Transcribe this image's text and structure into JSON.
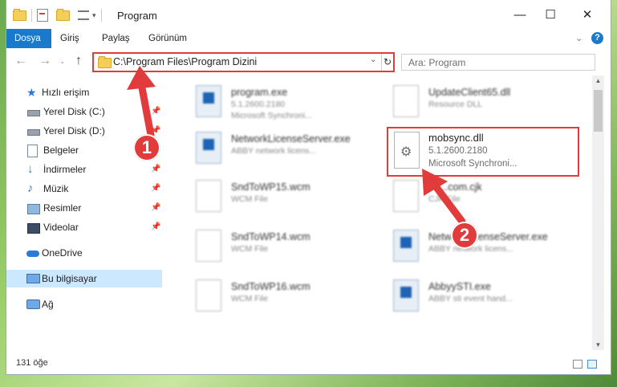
{
  "window": {
    "title": "Program",
    "controls": {
      "minimize": "—",
      "maximize": "☐",
      "close": "✕"
    }
  },
  "ribbon": {
    "tabs": [
      "Dosya",
      "Giriş",
      "Paylaş",
      "Görünüm"
    ],
    "active_tab": "Dosya",
    "help": "?"
  },
  "address": {
    "path": "C:\\Program Files\\Program Dizini",
    "search_placeholder": "Ara: Program"
  },
  "sidebar": {
    "quick_access": "Hızlı erişim",
    "items": [
      {
        "label": "Yerel Disk (C:)",
        "icon": "drive-icon",
        "pinned": true
      },
      {
        "label": "Yerel Disk (D:)",
        "icon": "drive-icon",
        "pinned": true
      },
      {
        "label": "Belgeler",
        "icon": "documents-icon",
        "pinned": true
      },
      {
        "label": "İndirmeler",
        "icon": "download-icon",
        "pinned": true
      },
      {
        "label": "Müzik",
        "icon": "music-icon",
        "pinned": true
      },
      {
        "label": "Resimler",
        "icon": "pictures-icon",
        "pinned": true
      },
      {
        "label": "Videolar",
        "icon": "videos-icon",
        "pinned": true
      }
    ],
    "onedrive": "OneDrive",
    "this_pc": "Bu bilgisayar",
    "network": "Ağ"
  },
  "files": [
    {
      "name": "program.exe",
      "line2": "5.1.2600.2180",
      "line3": "Microsoft Synchroni...",
      "type": "exe"
    },
    {
      "name": "UpdateClient65.dll",
      "line2": "Resource DLL",
      "line3": "",
      "type": "dll"
    },
    {
      "name": "NetworkLicenseServer.exe",
      "line2": "ABBY network licens...",
      "line3": "",
      "type": "exe"
    },
    {
      "name": "SndToWP15.wcm",
      "line2": "WCM File",
      "line3": "",
      "type": "doc"
    },
    {
      "name": "FF...com.cjk",
      "line2": "CJK File",
      "line3": "",
      "type": "doc"
    },
    {
      "name": "SndToWP14.wcm",
      "line2": "WCM File",
      "line3": "",
      "type": "doc"
    },
    {
      "name": "NetworkLicenseServer.exe",
      "line2": "ABBY network licens...",
      "line3": "",
      "type": "exe"
    },
    {
      "name": "SndToWP16.wcm",
      "line2": "WCM File",
      "line3": "",
      "type": "doc"
    },
    {
      "name": "AbbyySTI.exe",
      "line2": "ABBY sti event hand...",
      "line3": "",
      "type": "exe"
    }
  ],
  "highlighted_file": {
    "name": "mobsync.dll",
    "version": "5.1.2600.2180",
    "company": "Microsoft Synchroni..."
  },
  "status": {
    "count": "131 öğe"
  },
  "annotations": {
    "step1": "1",
    "step2": "2",
    "accent": "#e23b3b"
  }
}
